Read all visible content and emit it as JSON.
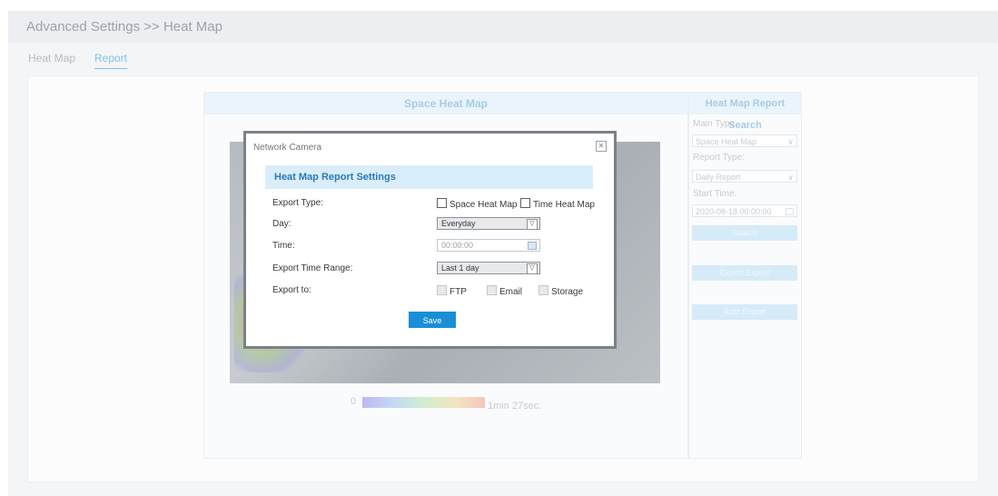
{
  "header": {
    "title": "Advanced Settings >> Heat Map"
  },
  "tabs": [
    {
      "label": "Heat Map"
    },
    {
      "label": "Report"
    }
  ],
  "main_panel": {
    "title": "Space Heat Map",
    "legend": {
      "min_label": "0",
      "max_label": "1min 27sec."
    }
  },
  "search_panel": {
    "title": "Heat Map Report Search",
    "main_type_label": "Main Type:",
    "main_type_value": "Space Heat Map",
    "report_type_label": "Report Type:",
    "report_type_value": "Daily Report",
    "start_time_label": "Start Time:",
    "start_time_value": "2020-08-18 00:00:00",
    "search_button": "Search",
    "export_button": "Export Export",
    "auto_export_button": "Auto Export"
  },
  "modal": {
    "title": "Network Camera",
    "close_glyph": "✕",
    "section_title": "Heat Map Report Settings",
    "export_type_label": "Export Type:",
    "export_type_options": [
      "Space Heat Map",
      "Time Heat Map"
    ],
    "day_label": "Day:",
    "day_value": "Everyday",
    "time_label": "Time:",
    "time_value": "00:00:00",
    "range_label": "Export Time Range:",
    "range_value": "Last 1 day",
    "export_to_label": "Export to:",
    "export_to_options": [
      "FTP",
      "Email",
      "Storage"
    ],
    "save_label": "Save"
  },
  "icons": {
    "chevron": "∨",
    "select_arrow": "▽"
  }
}
